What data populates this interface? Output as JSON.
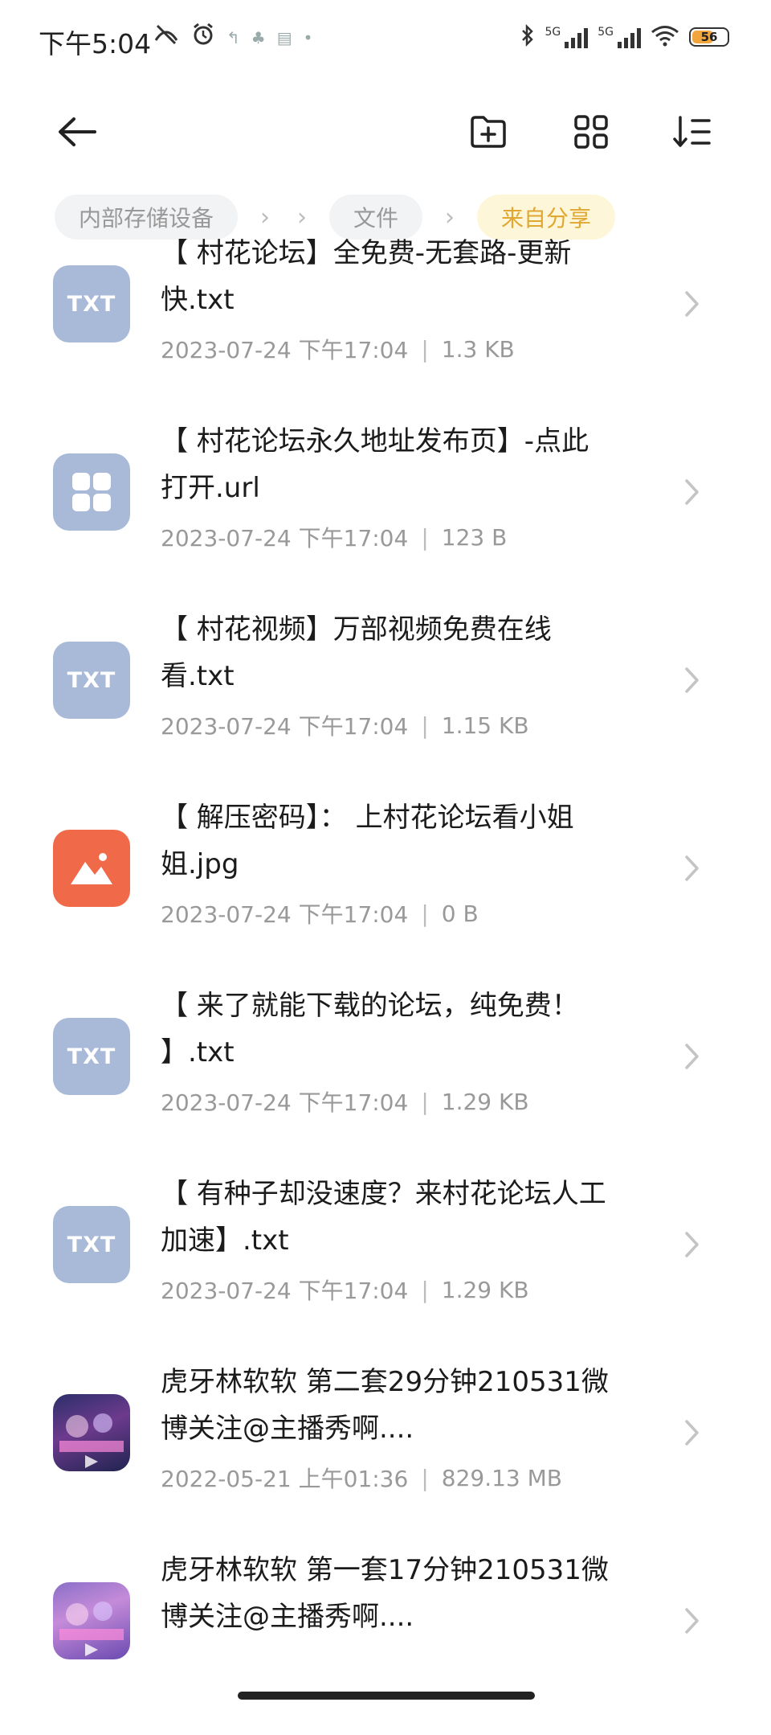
{
  "status_bar": {
    "time": "下午5:04",
    "battery_level": "56"
  },
  "toolbar": {
    "back_icon": "back-arrow-icon",
    "new_folder_icon": "new-folder-icon",
    "grid_view_icon": "grid-view-icon",
    "sort_icon": "sort-icon"
  },
  "breadcrumb": {
    "items": [
      "内部存储设备",
      "",
      "文件",
      "来自分享"
    ]
  },
  "files": [
    {
      "name": "【 村花论坛】全免费-无套路-更新快.txt",
      "date": "2023-07-24 下午17:04",
      "size": "1.3 KB",
      "icon_type": "txt",
      "icon_label": "TXT"
    },
    {
      "name": "【 村花论坛永久地址发布页】-点此打开.url",
      "date": "2023-07-24 下午17:04",
      "size": "123 B",
      "icon_type": "url",
      "icon_label": ""
    },
    {
      "name": "【 村花视频】万部视频免费在线看.txt",
      "date": "2023-07-24 下午17:04",
      "size": "1.15 KB",
      "icon_type": "txt",
      "icon_label": "TXT"
    },
    {
      "name": "【 解压密码】： 上村花论坛看小姐姐.jpg",
      "date": "2023-07-24 下午17:04",
      "size": "0 B",
      "icon_type": "img",
      "icon_label": ""
    },
    {
      "name": "【 来了就能下载的论坛，纯免费！ 】.txt",
      "date": "2023-07-24 下午17:04",
      "size": "1.29 KB",
      "icon_type": "txt",
      "icon_label": "TXT"
    },
    {
      "name": "【 有种子却没速度？来村花论坛人工加速】.txt",
      "date": "2023-07-24 下午17:04",
      "size": "1.29 KB",
      "icon_type": "txt",
      "icon_label": "TXT"
    },
    {
      "name": "虎牙林软软 第二套29分钟210531微博关注@主播秀啊....",
      "date": "2022-05-21 上午01:36",
      "size": "829.13 MB",
      "icon_type": "video1",
      "icon_label": ""
    },
    {
      "name": "虎牙林软软 第一套17分钟210531微博关注@主播秀啊....",
      "date": "",
      "size": "",
      "icon_type": "video2",
      "icon_label": ""
    }
  ]
}
